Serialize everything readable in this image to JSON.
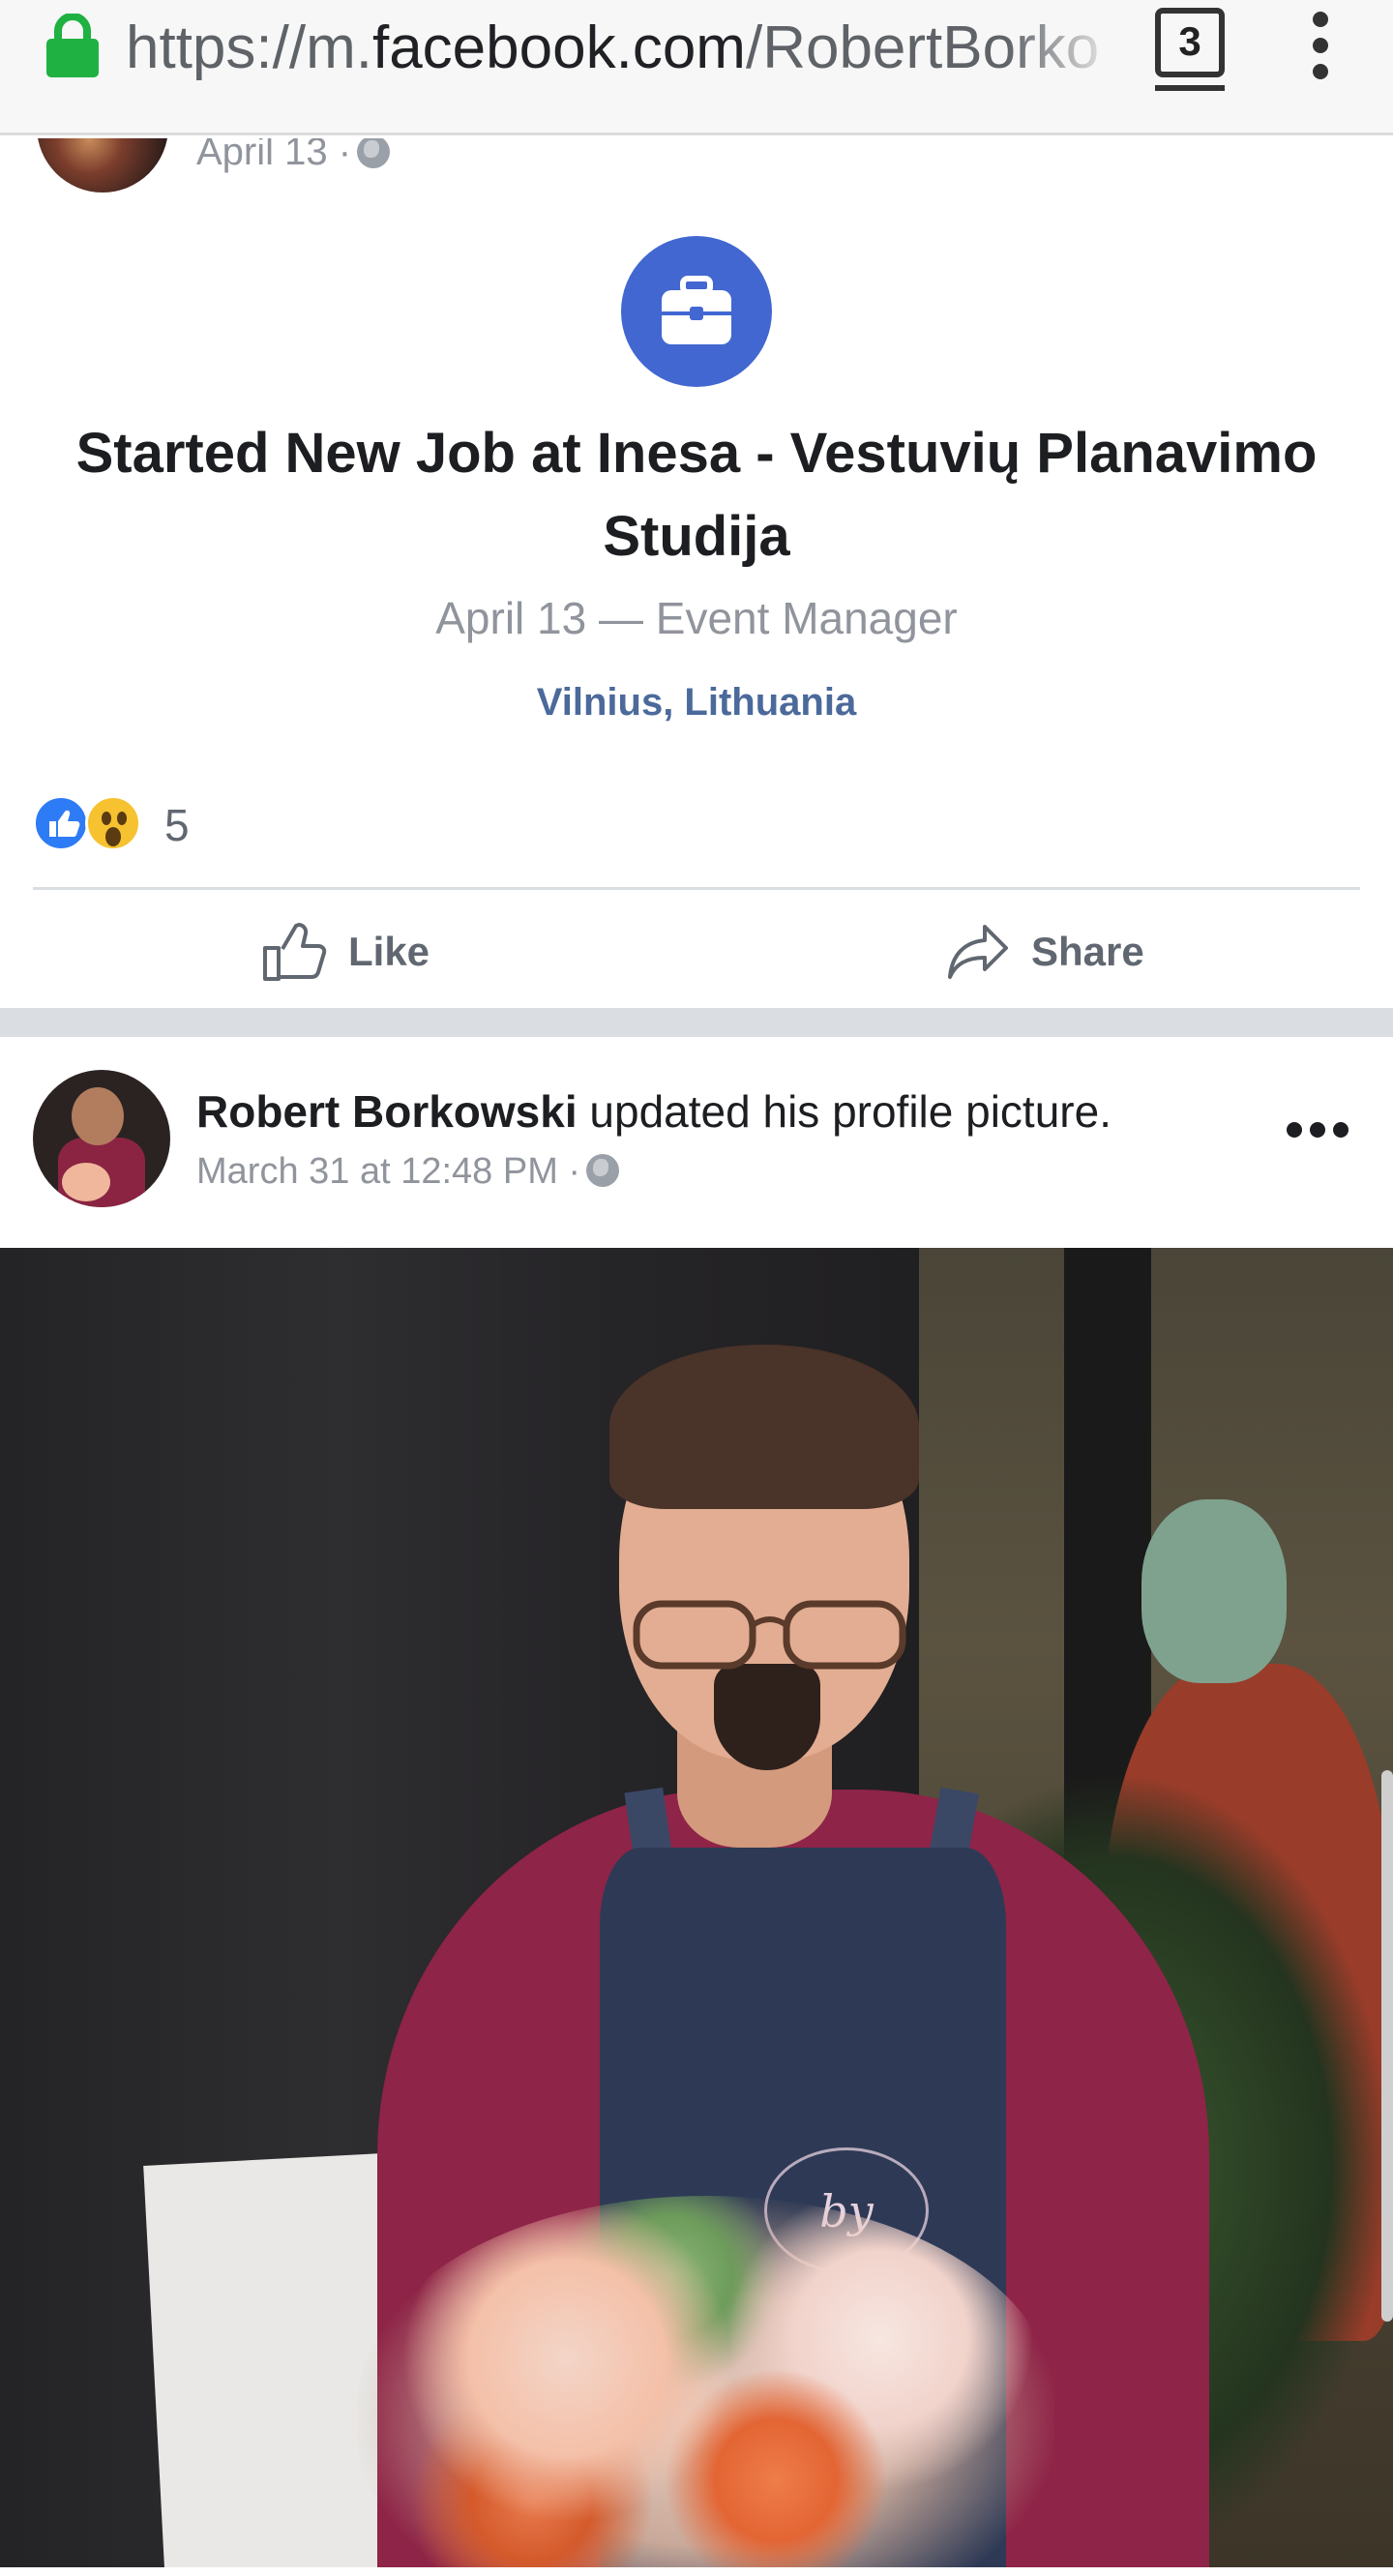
{
  "browser": {
    "url_scheme": "https://m.",
    "url_host": "facebook.com",
    "url_path": "/RobertBorko",
    "tab_count": "3"
  },
  "post1": {
    "date": "April 13 ·",
    "job_title": "Started New Job at Inesa - Vestuvių Planavimo Studija",
    "job_sub": "April 13 — Event Manager",
    "location": "Vilnius, Lithuania",
    "reaction_count": "5",
    "like_label": "Like",
    "share_label": "Share"
  },
  "post2": {
    "author": "Robert Borkowski",
    "action": " updated his profile picture.",
    "meta": "March 31 at 12:48 PM ·",
    "photo_logo_text": "by Inesa"
  },
  "colors": {
    "facebook_blue": "#4267d1",
    "link_blue": "#4b6a9b",
    "secure_lock_green": "#1fb141",
    "text_grey": "#90949c"
  },
  "icons": [
    "lock-icon",
    "tabs-icon",
    "overflow-menu-icon",
    "globe-icon",
    "briefcase-icon",
    "like-reaction-icon",
    "wow-reaction-icon",
    "thumbs-up-icon",
    "share-arrow-icon",
    "more-options-icon"
  ]
}
